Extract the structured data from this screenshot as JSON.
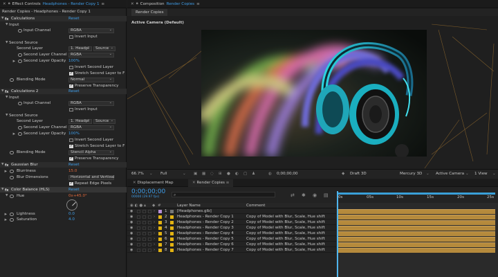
{
  "effect_controls": {
    "panel_title": "Effect Controls",
    "panel_target": "Headphones - Render Copy 1",
    "breadcrumb": "Render Copies - Headphones - Render Copy 1",
    "effects": [
      {
        "name": "Calculations",
        "reset": "Reset",
        "input_group": "Input",
        "input_channel_label": "Input Channel",
        "input_channel_value": "RGBA",
        "invert_input_label": "Invert Input",
        "second_source_group": "Second Source",
        "second_layer_label": "Second Layer",
        "second_layer_value": "1. Headpl",
        "second_layer_source": "Source",
        "second_layer_channel_label": "Second Layer Channel",
        "second_layer_channel_value": "RGBA",
        "second_layer_opacity_label": "Second Layer Opacity",
        "second_layer_opacity_value": "100%",
        "invert_second_label": "Invert Second Layer",
        "stretch_label": "Stretch Second Layer to F",
        "blending_mode_label": "Blending Mode",
        "blending_mode_value": "Normal",
        "preserve_label": "Preserve Transparency"
      },
      {
        "name": "Calculations 2",
        "reset": "Reset",
        "input_group": "Input",
        "input_channel_label": "Input Channel",
        "input_channel_value": "RGBA",
        "invert_input_label": "Invert Input",
        "second_source_group": "Second Source",
        "second_layer_label": "Second Layer",
        "second_layer_value": "1. Headpl",
        "second_layer_source": "Source",
        "second_layer_channel_label": "Second Layer Channel",
        "second_layer_channel_value": "RGBA",
        "second_layer_opacity_label": "Second Layer Opacity",
        "second_layer_opacity_value": "100%",
        "invert_second_label": "Invert Second Layer",
        "stretch_label": "Stretch Second Layer to F",
        "blending_mode_label": "Blending Mode",
        "blending_mode_value": "Stencil Alpha",
        "preserve_label": "Preserve Transparency"
      }
    ],
    "gaussian_blur": {
      "name": "Gaussian Blur",
      "reset": "Reset",
      "blurriness_label": "Blurriness",
      "blurriness_value": "15.0",
      "blur_dimensions_label": "Blur Dimensions",
      "blur_dimensions_value": "Horizontal and Vertical",
      "repeat_edge_label": "Repeat Edge Pixels"
    },
    "color_balance": {
      "name": "Color Balance (HLS)",
      "reset": "Reset",
      "hue_label": "Hue",
      "hue_value": "0x+45.0°",
      "lightness_label": "Lightness",
      "lightness_value": "0.0",
      "saturation_label": "Saturation",
      "saturation_value": "4.0"
    }
  },
  "composition": {
    "panel_title": "Composition",
    "panel_target": "Render Copies",
    "tab": "Render Copies",
    "camera_label": "Active Camera (Default)",
    "toolbar": {
      "zoom": "66.7%",
      "resolution": "Full",
      "timecode": "0;00;00;00",
      "renderer_label": "Draft 3D",
      "renderer": "Mercury 3D",
      "view_camera": "Active Camera",
      "views": "1 View"
    }
  },
  "timeline": {
    "tabs": [
      "Displacement Map",
      "Render Copies"
    ],
    "timecode": "0;00;00;00",
    "frame_info": "00000 (29.97 fps)",
    "columns": {
      "layer_name": "Layer Name",
      "comment": "Comment"
    },
    "ruler_ticks": [
      "0s",
      "05s",
      "10s",
      "15s",
      "20s",
      "25s"
    ],
    "layers": [
      {
        "num": "1",
        "name": "[Headphones.glb]",
        "comment": ""
      },
      {
        "num": "2",
        "name": "Headphones - Render Copy 1",
        "comment": "Copy of Model with Blur, Scale, Hue shift"
      },
      {
        "num": "3",
        "name": "Headphones - Render Copy 2",
        "comment": "Copy of Model with Blur, Scale, Hue shift"
      },
      {
        "num": "4",
        "name": "Headphones - Render Copy 3",
        "comment": "Copy of Model with Blur, Scale, Hue shift"
      },
      {
        "num": "5",
        "name": "Headphones - Render Copy 4",
        "comment": "Copy of Model with Blur, Scale, Hue shift"
      },
      {
        "num": "6",
        "name": "Headphones - Render Copy 5",
        "comment": "Copy of Model with Blur, Scale, Hue shift"
      },
      {
        "num": "7",
        "name": "Headphones - Render Copy 6",
        "comment": "Copy of Model with Blur, Scale, Hue shift"
      },
      {
        "num": "8",
        "name": "Headphones - Render Copy 7",
        "comment": "Copy of Model with Blur, Scale, Hue shift"
      }
    ]
  },
  "colors": {
    "accent": "#3f9de8",
    "label_yellow": "#e3b312",
    "clip_bar": "#b58a3c",
    "work_area": "#3aa0d8"
  }
}
